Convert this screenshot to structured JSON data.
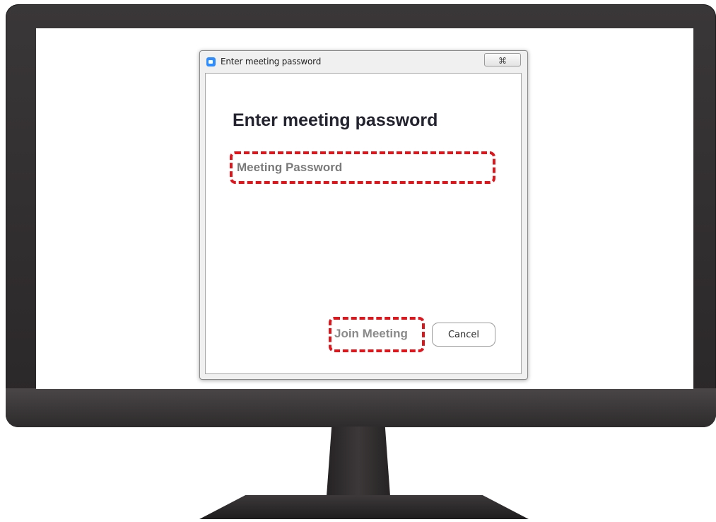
{
  "window": {
    "title": "Enter meeting password",
    "close_label": "⌘"
  },
  "dialog": {
    "heading": "Enter meeting password",
    "password_placeholder": "Meeting Password",
    "password_value": "",
    "join_label": "Join Meeting",
    "cancel_label": "Cancel"
  },
  "icons": {
    "app_icon": "zoom-app-icon",
    "close_icon": "close-icon"
  },
  "colors": {
    "highlight": "#e0141b",
    "app_accent": "#2d8cff",
    "heading": "#23232f",
    "monitor": "#2f2c2d"
  }
}
